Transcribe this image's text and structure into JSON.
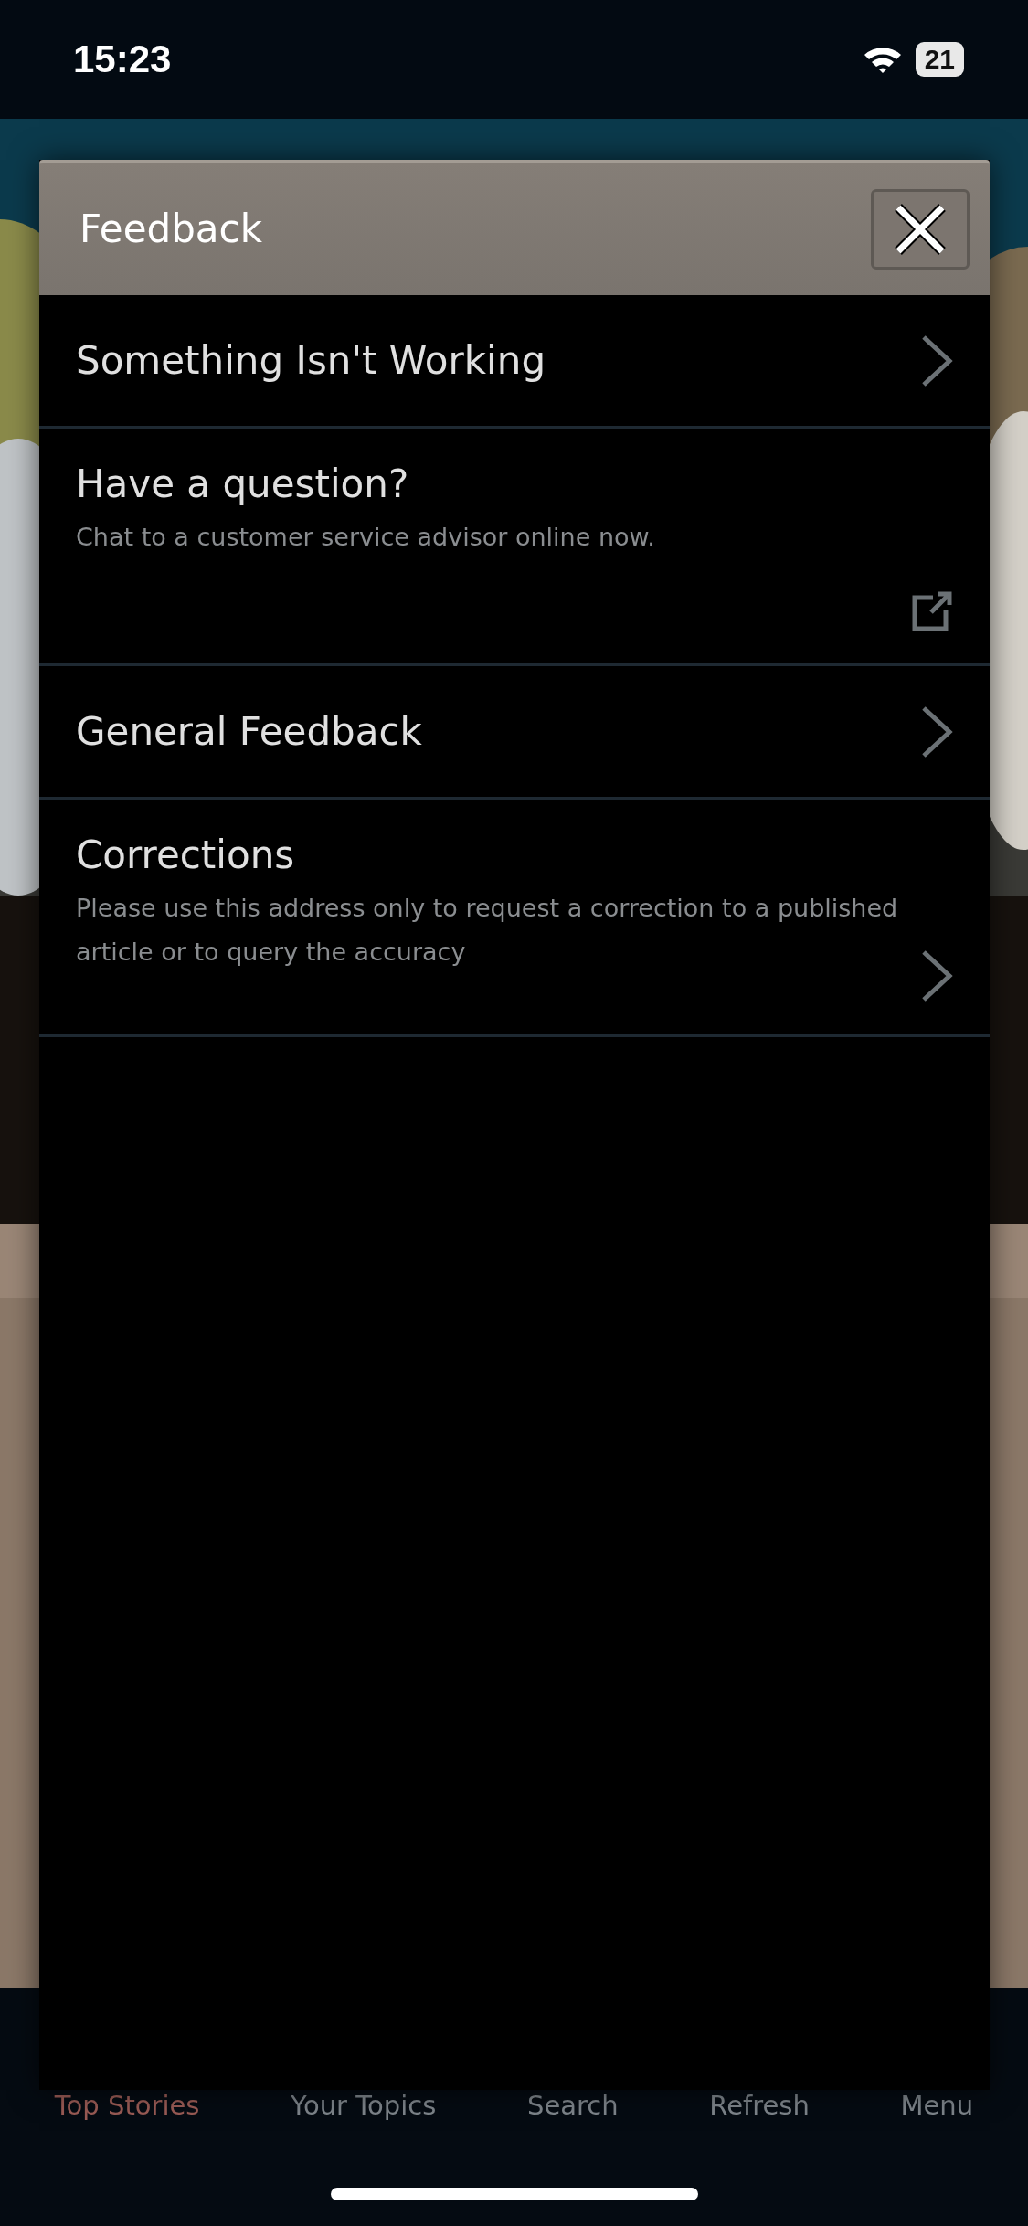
{
  "status_bar": {
    "time": "15:23",
    "battery": "21"
  },
  "dialog": {
    "title": "Feedback",
    "rows": [
      {
        "kind": "chevron",
        "title": "Something Isn't Working"
      },
      {
        "kind": "external",
        "title": "Have a question?",
        "subtitle": "Chat to a customer service advisor online now."
      },
      {
        "kind": "chevron",
        "title": "General Feedback"
      },
      {
        "kind": "chevron",
        "title": "Corrections",
        "subtitle": "Please use this address only to request a correction to a published article or to query the accuracy"
      }
    ]
  },
  "tab_bar": [
    {
      "label": "Top Stories",
      "selected": true
    },
    {
      "label": "Your Topics",
      "selected": false
    },
    {
      "label": "Search",
      "selected": false
    },
    {
      "label": "Refresh",
      "selected": false
    },
    {
      "label": "Menu",
      "selected": false
    }
  ]
}
